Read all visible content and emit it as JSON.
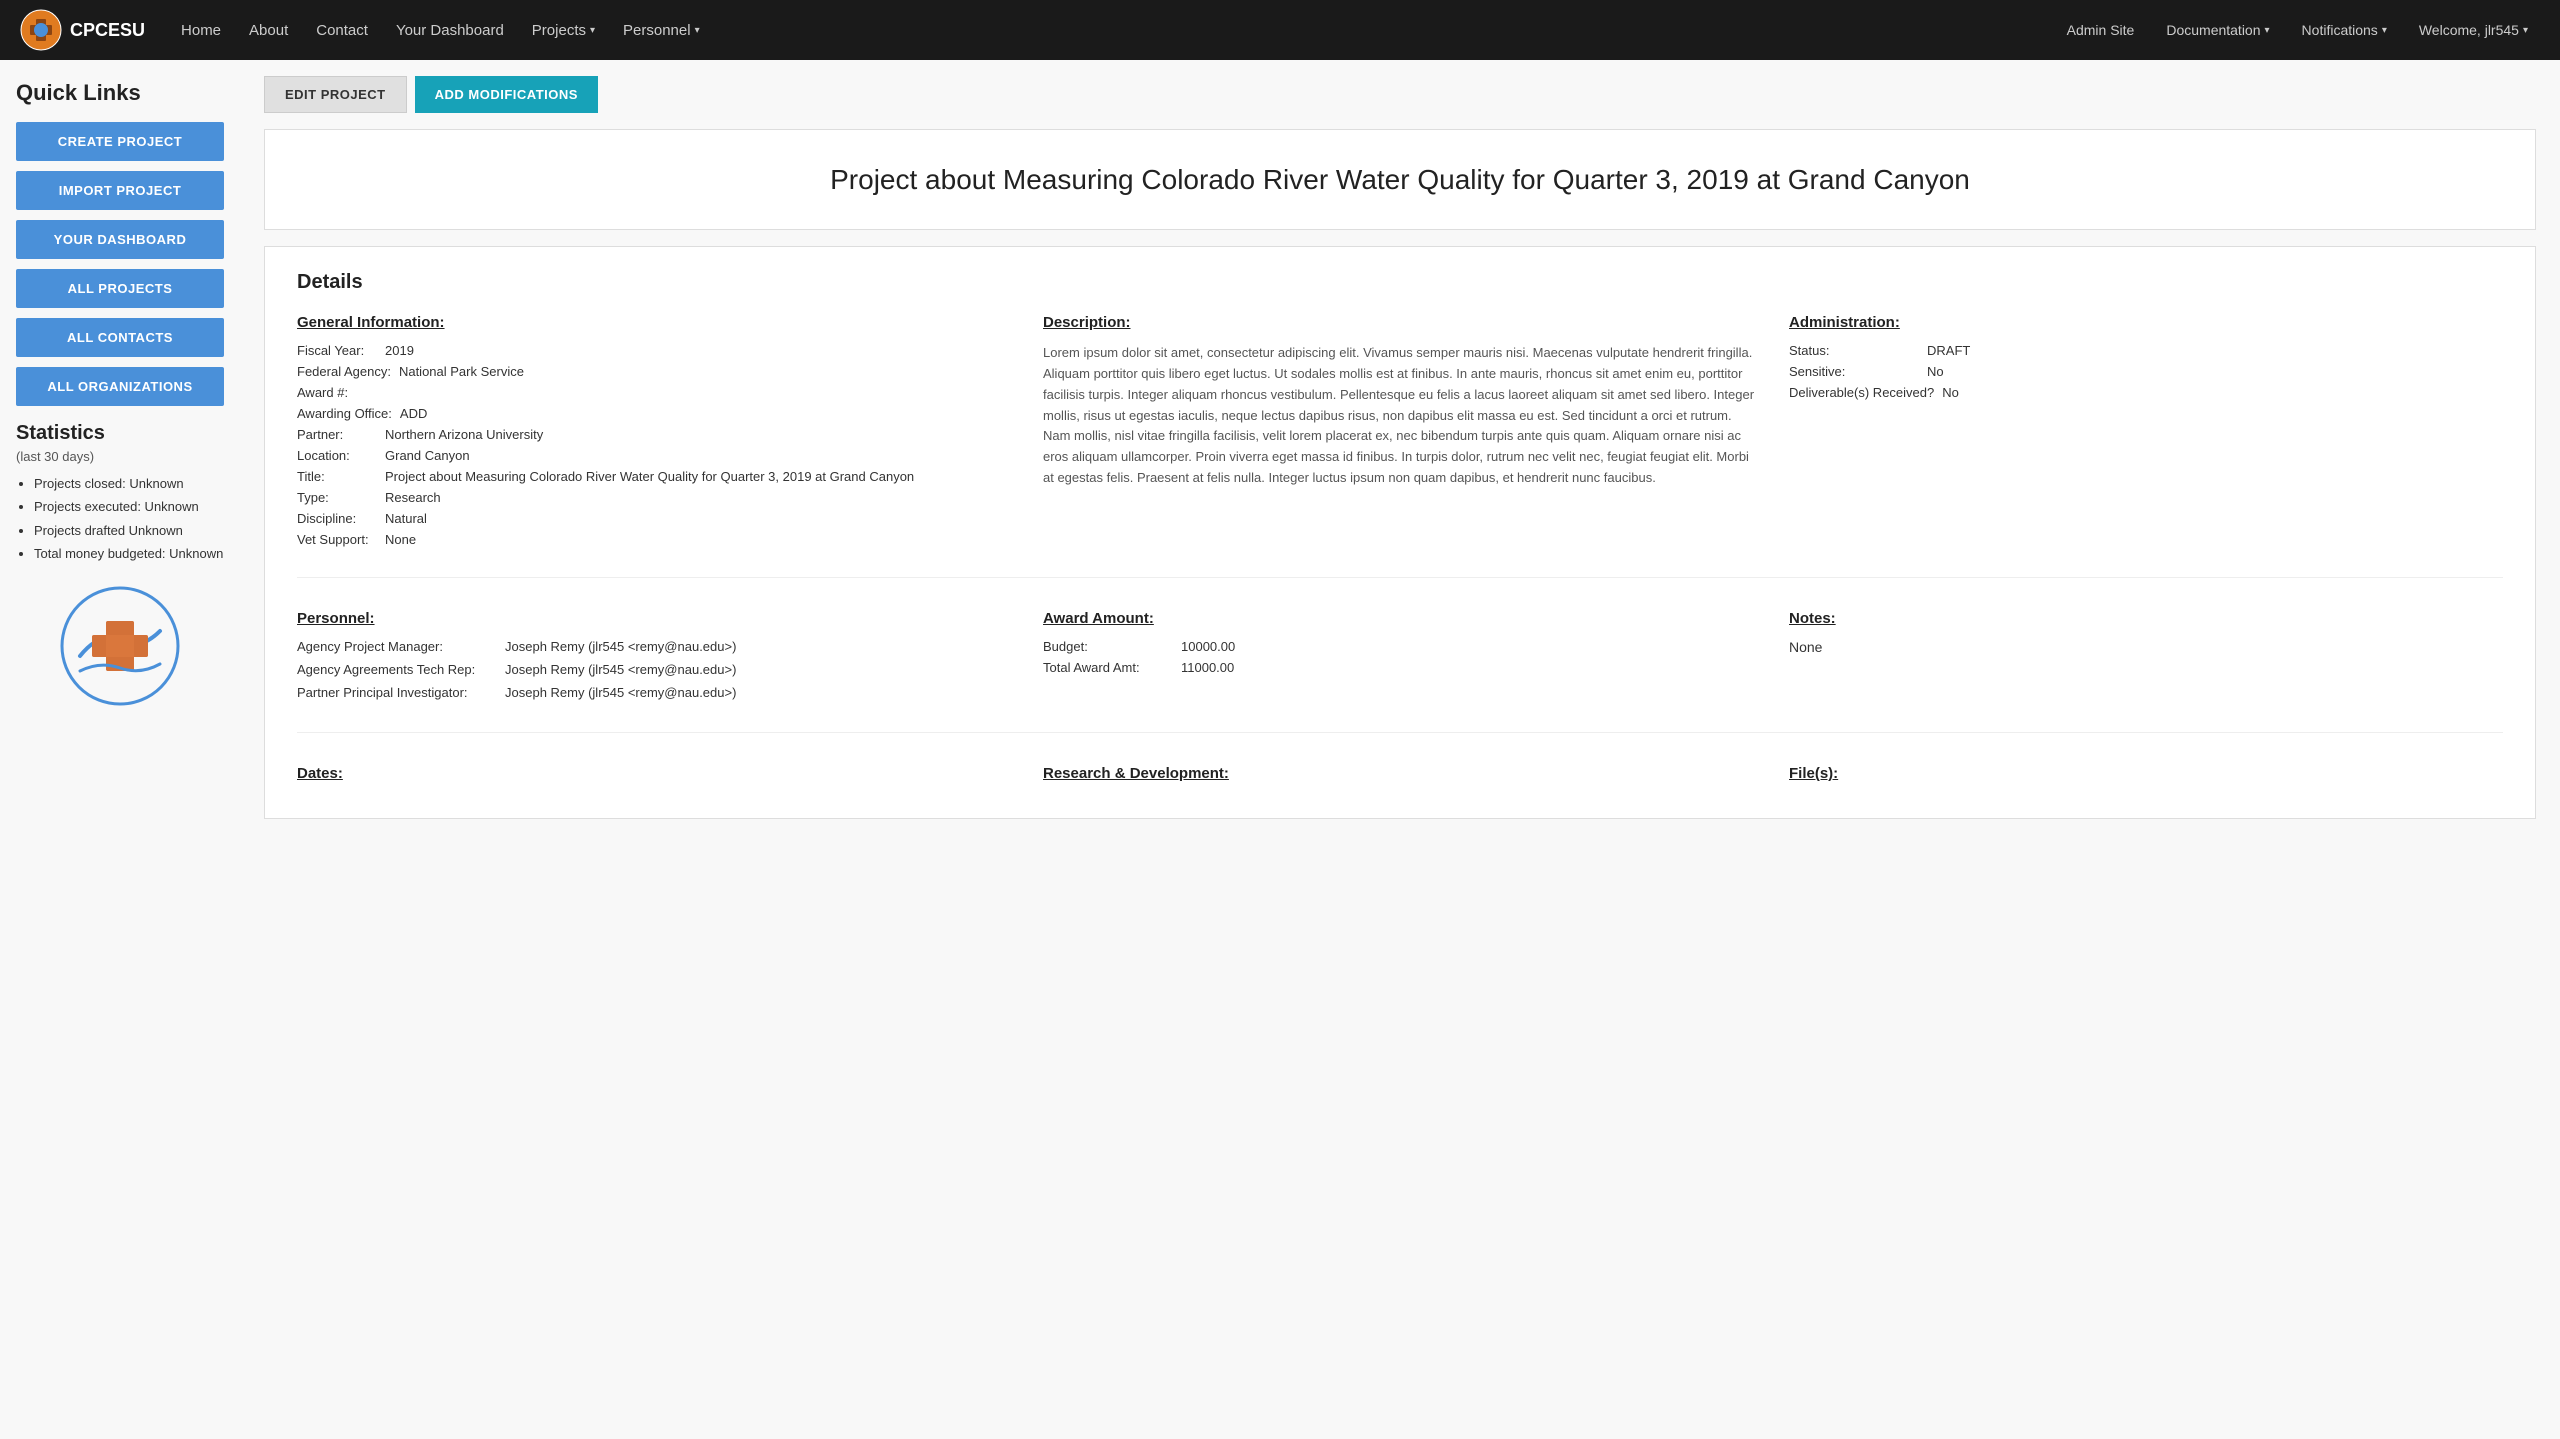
{
  "navbar": {
    "brand": "CPCESU",
    "nav_items": [
      {
        "label": "Home",
        "href": "#",
        "dropdown": false
      },
      {
        "label": "About",
        "href": "#",
        "dropdown": false
      },
      {
        "label": "Contact",
        "href": "#",
        "dropdown": false
      },
      {
        "label": "Your Dashboard",
        "href": "#",
        "dropdown": false
      },
      {
        "label": "Projects",
        "href": "#",
        "dropdown": true
      },
      {
        "label": "Personnel",
        "href": "#",
        "dropdown": true
      }
    ],
    "right_items": [
      {
        "label": "Admin Site",
        "href": "#",
        "dropdown": false
      },
      {
        "label": "Documentation",
        "href": "#",
        "dropdown": true
      },
      {
        "label": "Notifications",
        "href": "#",
        "dropdown": true
      },
      {
        "label": "Welcome, jlr545",
        "href": "#",
        "dropdown": true
      }
    ]
  },
  "sidebar": {
    "quick_links_title": "Quick Links",
    "buttons": [
      {
        "label": "CREATE PROJECT",
        "name": "create-project-btn"
      },
      {
        "label": "IMPORT PROJECT",
        "name": "import-project-btn"
      },
      {
        "label": "YOUR DASHBOARD",
        "name": "your-dashboard-btn"
      },
      {
        "label": "ALL PROJECTS",
        "name": "all-projects-btn"
      },
      {
        "label": "ALL CONTACTS",
        "name": "all-contacts-btn"
      },
      {
        "label": "ALL ORGANIZATIONS",
        "name": "all-organizations-btn"
      }
    ],
    "statistics_title": "Statistics",
    "statistics_subtitle": "(last 30 days)",
    "statistics_items": [
      "Projects closed: Unknown",
      "Projects executed: Unknown",
      "Projects drafted Unknown",
      "Total money budgeted: Unknown"
    ]
  },
  "action_buttons": {
    "edit_label": "EDIT PROJECT",
    "add_mod_label": "ADD MODIFICATIONS"
  },
  "project": {
    "title": "Project about Measuring Colorado River Water Quality for Quarter 3, 2019 at Grand Canyon",
    "details_heading": "Details",
    "general_info": {
      "heading": "General Information:",
      "fiscal_year_label": "Fiscal Year:",
      "fiscal_year": "2019",
      "federal_agency_label": "Federal Agency:",
      "federal_agency": "National Park Service",
      "award_num_label": "Award #:",
      "award_num": "",
      "awarding_office_label": "Awarding Office:",
      "awarding_office": "ADD",
      "partner_label": "Partner:",
      "partner": "Northern Arizona University",
      "location_label": "Location:",
      "location": "Grand Canyon",
      "title_label": "Title:",
      "title_val": "Project about Measuring Colorado River Water Quality for Quarter 3, 2019 at Grand Canyon",
      "type_label": "Type:",
      "type_val": "Research",
      "discipline_label": "Discipline:",
      "discipline_val": "Natural",
      "vet_support_label": "Vet Support:",
      "vet_support_val": "None"
    },
    "description": {
      "heading": "Description:",
      "text": "Lorem ipsum dolor sit amet, consectetur adipiscing elit. Vivamus semper mauris nisi. Maecenas vulputate hendrerit fringilla. Aliquam porttitor quis libero eget luctus. Ut sodales mollis est at finibus. In ante mauris, rhoncus sit amet enim eu, porttitor facilisis turpis. Integer aliquam rhoncus vestibulum. Pellentesque eu felis a lacus laoreet aliquam sit amet sed libero. Integer mollis, risus ut egestas iaculis, neque lectus dapibus risus, non dapibus elit massa eu est. Sed tincidunt a orci et rutrum. Nam mollis, nisl vitae fringilla facilisis, velit lorem placerat ex, nec bibendum turpis ante quis quam. Aliquam ornare nisi ac eros aliquam ullamcorper. Proin viverra eget massa id finibus. In turpis dolor, rutrum nec velit nec, feugiat feugiat elit. Morbi at egestas felis. Praesent at felis nulla. Integer luctus ipsum non quam dapibus, et hendrerit nunc faucibus."
    },
    "administration": {
      "heading": "Administration:",
      "status_label": "Status:",
      "status_val": "DRAFT",
      "sensitive_label": "Sensitive:",
      "sensitive_val": "No",
      "deliverables_label": "Deliverable(s) Received?",
      "deliverables_val": "No"
    },
    "personnel": {
      "heading": "Personnel:",
      "fields": [
        {
          "label": "Agency Project Manager:",
          "value": "Joseph Remy (jlr545 <remy@nau.edu>)"
        },
        {
          "label": "Agency Agreements Tech Rep:",
          "value": "Joseph Remy (jlr545 <remy@nau.edu>)"
        },
        {
          "label": "Partner Principal Investigator:",
          "value": "Joseph Remy (jlr545 <remy@nau.edu>)"
        }
      ]
    },
    "award_amount": {
      "heading": "Award Amount:",
      "budget_label": "Budget:",
      "budget_val": "10000.00",
      "total_award_label": "Total Award Amt:",
      "total_award_val": "11000.00"
    },
    "notes": {
      "heading": "Notes:",
      "text": "None"
    },
    "dates": {
      "heading": "Dates:"
    },
    "research_development": {
      "heading": "Research & Development:"
    },
    "files": {
      "heading": "File(s):"
    }
  }
}
